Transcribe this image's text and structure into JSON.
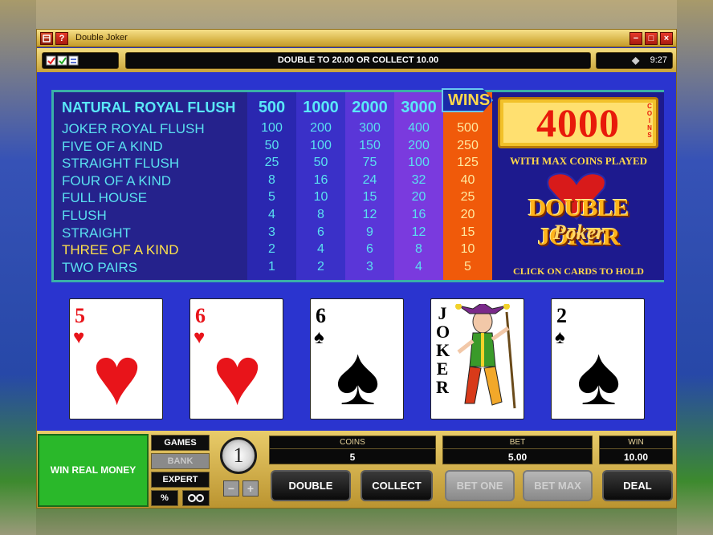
{
  "window": {
    "title": "Double Joker",
    "controls": {
      "minimize": "−",
      "maximize": "□",
      "close": "×"
    },
    "left_icons": [
      "menu-icon",
      "help-icon"
    ],
    "help_label": "?"
  },
  "status": {
    "message": "DOUBLE TO 20.00 OR COLLECT 10.00",
    "time": "9:27"
  },
  "paytable": {
    "columns": [
      "500",
      "1000",
      "2000",
      "3000"
    ],
    "wins_label": "WINS",
    "rows": [
      {
        "hand": "NATURAL ROYAL FLUSH",
        "values": [
          "500",
          "1000",
          "2000",
          "3000",
          ""
        ]
      },
      {
        "hand": "JOKER ROYAL FLUSH",
        "values": [
          "100",
          "200",
          "300",
          "400",
          "500"
        ]
      },
      {
        "hand": "FIVE OF A KIND",
        "values": [
          "50",
          "100",
          "150",
          "200",
          "250"
        ]
      },
      {
        "hand": "STRAIGHT FLUSH",
        "values": [
          "25",
          "50",
          "75",
          "100",
          "125"
        ]
      },
      {
        "hand": "FOUR OF A KIND",
        "values": [
          "8",
          "16",
          "24",
          "32",
          "40"
        ]
      },
      {
        "hand": "FULL HOUSE",
        "values": [
          "5",
          "10",
          "15",
          "20",
          "25"
        ]
      },
      {
        "hand": "FLUSH",
        "values": [
          "4",
          "8",
          "12",
          "16",
          "20"
        ]
      },
      {
        "hand": "STRAIGHT",
        "values": [
          "3",
          "6",
          "9",
          "12",
          "15"
        ]
      },
      {
        "hand": "THREE OF A KIND",
        "values": [
          "2",
          "4",
          "6",
          "8",
          "10"
        ]
      },
      {
        "hand": "TWO PAIRS",
        "values": [
          "1",
          "2",
          "3",
          "4",
          "5"
        ]
      }
    ]
  },
  "promo": {
    "max_win": "4000",
    "coins_word": "COINS",
    "max_coins_text": "WITH MAX COINS PLAYED",
    "logo_title": "DOUBLE JOKER",
    "logo_sub": "Poker",
    "hold_text": "CLICK ON CARDS TO HOLD"
  },
  "cards": [
    {
      "rank": "5",
      "suit": "♥",
      "color": "red"
    },
    {
      "rank": "6",
      "suit": "♥",
      "color": "red"
    },
    {
      "rank": "6",
      "suit": "♠",
      "color": "black"
    },
    {
      "rank": "JOKER",
      "suit": "",
      "color": "black"
    },
    {
      "rank": "2",
      "suit": "♠",
      "color": "black"
    }
  ],
  "bottom": {
    "win_real_money": "WIN REAL MONEY",
    "games": "GAMES",
    "bank": "BANK",
    "expert": "EXPERT",
    "percent": "%",
    "chip_value": "1",
    "minus": "−",
    "plus": "+",
    "coins_label": "COINS",
    "coins_value": "5",
    "bet_label": "BET",
    "bet_value": "5.00",
    "win_label": "WIN",
    "win_value": "10.00",
    "double": "DOUBLE",
    "collect": "COLLECT",
    "bet_one": "BET ONE",
    "bet_max": "BET MAX",
    "deal": "DEAL"
  },
  "colors": {
    "table_bg": "#2a34cf",
    "wins_column": "#f05a0a",
    "gold_panel": "#e9cc6a",
    "hand_text": "#5ae0f0",
    "highlight_text": "#ffe24a"
  }
}
